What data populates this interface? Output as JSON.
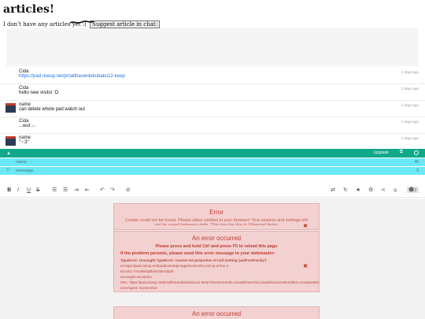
{
  "heading": "articles!",
  "no_articles_text": "I don't have any articles yet :(",
  "suggest_button": "Suggest article in chat:",
  "messages": [
    {
      "name": "Cida",
      "text": "https://pad.riseup.net/p/salthaverdekubaku12-keep",
      "time": "2 days ago",
      "link": true,
      "avatar": false
    },
    {
      "name": "Cida",
      "text": "hello new visitor :D",
      "time": "2 days ago",
      "link": false,
      "avatar": false
    },
    {
      "name": "name",
      "text": "can delete whole pad watch out",
      "time": "2 days ago",
      "link": false,
      "avatar": true
    },
    {
      "name": "Cida",
      "text": "...wut ;-.",
      "time": "2 days ago",
      "link": false,
      "avatar": false
    },
    {
      "name": "name",
      "text": "\"~:3\"",
      "time": "2 days ago",
      "link": false,
      "avatar": true
    }
  ],
  "bar": {
    "upgrade_label": "Upgrade"
  },
  "inputs": {
    "name_label": "name",
    "name_count": "40",
    "message_label": "message",
    "message_count": "0"
  },
  "toolbar": {
    "bold": "B",
    "italic": "I",
    "underline": "U",
    "strike": "S",
    "users_count": "2"
  },
  "errors": {
    "e1_title": "Error",
    "e1_body": "Cookie could not be found. Please allow cookies in your browser! Your session and settings will not be saved between visits. This may be due to Etherpad being",
    "e2_title": "An error occurred",
    "e2_line1": "Please press and hold Ctrl and press F5 to reload this page",
    "e2_line2": "If the problem persists, please send this error message to your webmaster:",
    "e2_details": [
      "TypeError: Uncaught TypeError: Cannot set properties of null (setting 'padFontFamily')",
      "at https://pad.riseup.net/padbootstrap-5ygN5V2KmRo.min.js at line 4",
      "ErrorId: eYL59s0q0bosOMnotp29",
      "Uncaught exception",
      "URL: https://pad.riseup.net/p/salthaverdekubaku12-keep?showControls=true&showChat=true&showLineNumbers=true&useMonospaceFont=false",
      "UserAgent: Screenshot"
    ],
    "e3_title": "An error occurred"
  }
}
